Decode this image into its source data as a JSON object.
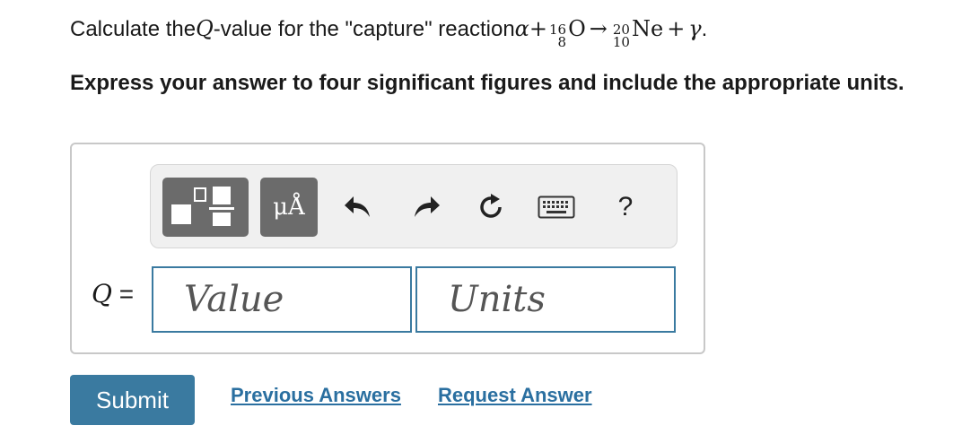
{
  "question": {
    "prefix": "Calculate the ",
    "q_symbol": "Q",
    "middle": "-value for the \"capture\" reaction ",
    "alpha": "α",
    "plus1": "+",
    "o_mass": "16",
    "o_atomic": "8",
    "o_symbol": "O",
    "arrow": "→",
    "ne_mass": "20",
    "ne_atomic": "10",
    "ne_symbol": "Ne",
    "plus2": "+",
    "gamma": "γ",
    "end": "."
  },
  "instruction": "Express your answer to four significant figures and include the appropriate units.",
  "toolbar": {
    "units_label": "μÅ",
    "help_label": "?",
    "icons": [
      "templates-icon",
      "units-icon",
      "undo-icon",
      "redo-icon",
      "reset-icon",
      "keyboard-icon",
      "help-icon"
    ]
  },
  "answer": {
    "label": "Q",
    "equals": " =",
    "value_placeholder": "Value",
    "units_placeholder": "Units"
  },
  "actions": {
    "submit": "Submit",
    "previous": "Previous Answers",
    "request": "Request Answer"
  },
  "colors": {
    "accent": "#3a7aa0",
    "toolbar_button": "#6b6b6b",
    "link": "#2a6fa0"
  }
}
